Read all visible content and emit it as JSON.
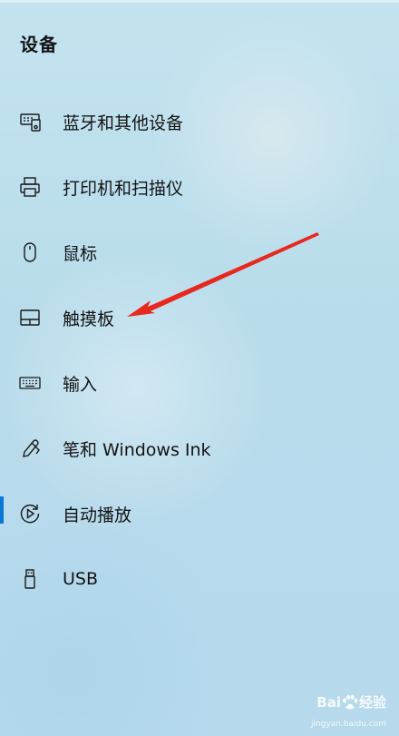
{
  "page": {
    "title": "设备"
  },
  "nav": {
    "items": [
      {
        "label": "蓝牙和其他设备",
        "icon": "bluetooth-devices-icon",
        "selected": false
      },
      {
        "label": "打印机和扫描仪",
        "icon": "printer-icon",
        "selected": false
      },
      {
        "label": "鼠标",
        "icon": "mouse-icon",
        "selected": false
      },
      {
        "label": "触摸板",
        "icon": "touchpad-icon",
        "selected": true
      },
      {
        "label": "输入",
        "icon": "keyboard-icon",
        "selected": false
      },
      {
        "label": "笔和 Windows Ink",
        "icon": "pen-icon",
        "selected": false
      },
      {
        "label": "自动播放",
        "icon": "autoplay-icon",
        "selected": false
      },
      {
        "label": "USB",
        "icon": "usb-icon",
        "selected": false
      }
    ]
  },
  "colors": {
    "accent": "#0a78d4",
    "annotation_arrow": "#e8281e",
    "text": "#141414"
  },
  "watermark": {
    "brand": "Bai",
    "brand_suffix": "经验",
    "url": "jingyan.baidu.com"
  }
}
